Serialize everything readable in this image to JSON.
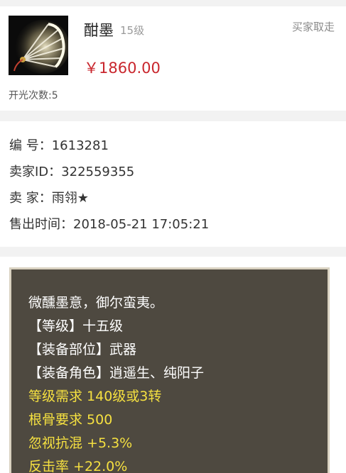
{
  "item": {
    "name": "酣墨",
    "level": "15级",
    "status": "买家取走",
    "price": "￥1860.00",
    "open_count": "开光次数:5"
  },
  "info": {
    "id_label": "编  号：",
    "id_value": "1613281",
    "seller_id_label": "卖家ID：",
    "seller_id_value": "322559355",
    "seller_label": "卖  家：",
    "seller_value": "雨翎★",
    "sold_time_label": "售出时间：",
    "sold_time_value": "2018-05-21 17:05:21"
  },
  "description": {
    "lines": [
      "微醺墨意，御尔蛮夷。",
      "【等级】十五级",
      "【装备部位】武器",
      "【装备角色】逍遥生、纯阳子",
      "等级需求 140级或3转",
      "根骨要求 500",
      "忽视抗混 +5.3%",
      "反击率 +22.0%"
    ],
    "colors": {
      "white": "#ffffff",
      "yellow": "#f5e040",
      "panel": "#4e4940"
    }
  },
  "colors": {
    "price": "#c9262d"
  },
  "icons": {
    "thumbnail": "fan-weapon-icon"
  }
}
